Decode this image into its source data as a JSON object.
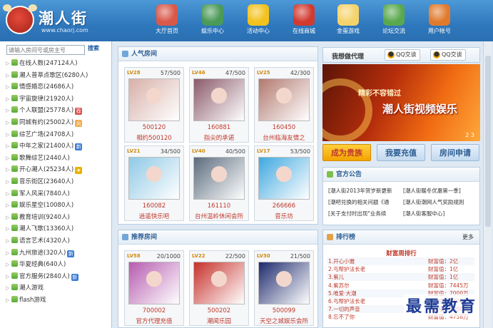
{
  "header": {
    "brand": "潮人街",
    "url": "www.chaorj.com",
    "nav": [
      {
        "label": "大厅首页",
        "icon": "home-icon",
        "color": "#d9584a"
      },
      {
        "label": "娱乐中心",
        "icon": "games-icon",
        "color": "#4b9a58"
      },
      {
        "label": "活动中心",
        "icon": "star-icon",
        "color": "#f3c21d"
      },
      {
        "label": "在线商城",
        "icon": "cart-icon",
        "color": "#d23a2f"
      },
      {
        "label": "金蛋游戏",
        "icon": "egg-icon",
        "color": "#f5d36a"
      },
      {
        "label": "论坛交流",
        "icon": "forum-icon",
        "color": "#5aa84e"
      },
      {
        "label": "用户帐号",
        "icon": "user-icon",
        "color": "#e07a2c"
      }
    ]
  },
  "sidebar": {
    "search_placeholder": "请输入房间号或房主号",
    "search_button": "搜索",
    "items": [
      {
        "label": "在线人数(247124人)",
        "badge": ""
      },
      {
        "label": "潮人普萃点歌区(6280人)",
        "badge": ""
      },
      {
        "label": "情感婚恋(24686人)",
        "badge": ""
      },
      {
        "label": "宇宙旋律(21920人)",
        "badge": ""
      },
      {
        "label": "个人联盟(25778人)",
        "badge": "荐"
      },
      {
        "label": "同城有约(25002人)",
        "badge": "火"
      },
      {
        "label": "综艺广场(24708人)",
        "badge": ""
      },
      {
        "label": "中年之家(21400人)",
        "badge": "新"
      },
      {
        "label": "歌舞综艺(2440人)",
        "badge": ""
      },
      {
        "label": "开心潮人(25234人)",
        "badge": "★"
      },
      {
        "label": "音乐街区(23640人)",
        "badge": ""
      },
      {
        "label": "军人风采(7840人)",
        "badge": ""
      },
      {
        "label": "娱乐星空(10080人)",
        "badge": ""
      },
      {
        "label": "教育培训(9240人)",
        "badge": ""
      },
      {
        "label": "潮人飞歌(13360人)",
        "badge": ""
      },
      {
        "label": "语言艺术(4320人)",
        "badge": ""
      },
      {
        "label": "九州旅途(320人)",
        "badge": "新"
      },
      {
        "label": "华夏经典(640人)",
        "badge": ""
      },
      {
        "label": "官方服务(2840人)",
        "badge": "新"
      },
      {
        "label": "潮人游戏",
        "badge": ""
      },
      {
        "label": "flash游戏",
        "badge": ""
      }
    ]
  },
  "popular": {
    "title": "人气房间",
    "rooms": [
      {
        "level": "LV28",
        "count": "57/500",
        "id": "500120",
        "name": "相约500120",
        "pic": "#d7b0a8"
      },
      {
        "level": "LV46",
        "count": "47/500",
        "id": "160881",
        "name": "指尖的承诺",
        "pic": "#8a5a6a"
      },
      {
        "level": "LV25",
        "count": "42/300",
        "id": "160450",
        "name": "台州临海友情之",
        "pic": "#b2796f"
      },
      {
        "level": "LV21",
        "count": "34/500",
        "id": "160082",
        "name": "逍遥快乐吧",
        "pic": "#8fc9e6"
      },
      {
        "level": "LV40",
        "count": "40/500",
        "id": "161110",
        "name": "台州温岭休闲会所",
        "pic": "#5b6b7d"
      },
      {
        "level": "LV17",
        "count": "53/500",
        "id": "266666",
        "name": "音乐坊",
        "pic": "#3fa8e0"
      }
    ]
  },
  "recommended": {
    "title": "推荐房间",
    "rooms": [
      {
        "level": "LV58",
        "count": "20/1000",
        "id": "700002",
        "name": "官方代理充值",
        "pic": "#b65bb0"
      },
      {
        "level": "LV22",
        "count": "22/500",
        "id": "500202",
        "name": "潮闻乐园",
        "pic": "#c6302a"
      },
      {
        "level": "LV30",
        "count": "21/500",
        "id": "500099",
        "name": "天空之城娱乐会所",
        "pic": "#1d2a6d"
      }
    ]
  },
  "agent": {
    "title": "我想做代理",
    "qq1": "QQ交谈",
    "qq2": "QQ交谈"
  },
  "banner": {
    "line1": "精彩不容错过",
    "line2": "潮人街视频娱乐",
    "pages": "2  3"
  },
  "actions": {
    "noble": "成为贵族",
    "recharge": "我要充值",
    "apply": "房间申请"
  },
  "notice": {
    "title": "官方公告",
    "items": [
      "[潮人街2013年贺岁新更新",
      "[潮人街暖冬优惠第一季]",
      "[潮吧兑换的相关问题《通",
      "[潮人街潮网人气奖励规则",
      "[关于支付时出现\"业务续",
      "[潮人街客服中心]"
    ]
  },
  "ranking": {
    "title": "排行榜",
    "more": "更多",
    "subtitle": "财富周排行",
    "rows": [
      {
        "name": "1.开心小雅",
        "value": "财富值：2亿"
      },
      {
        "name": "2.丐帮护法长老",
        "value": "财富值：1亿"
      },
      {
        "name": "3.紫儿",
        "value": "财富值：1亿"
      },
      {
        "name": "4.紫苏尔",
        "value": "财富值：7445万"
      },
      {
        "name": "5.唯爱·大潮",
        "value": "财富值：7000万"
      },
      {
        "name": "6.丐帮护法长老",
        "value": "财富值：6100万"
      },
      {
        "name": "7.一切的声音",
        "value": "财富值：5000万"
      },
      {
        "name": "8.忘不了你",
        "value": "财富值：4758万"
      }
    ]
  },
  "watermark": "最需教育"
}
